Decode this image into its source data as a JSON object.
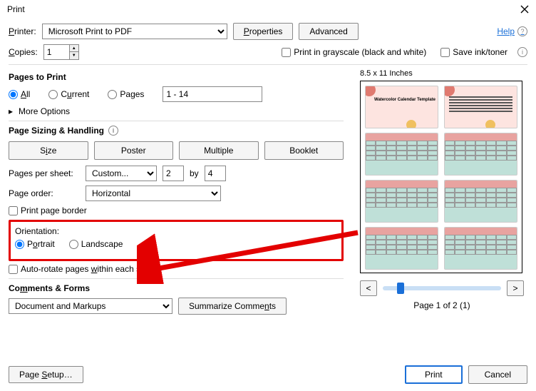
{
  "window": {
    "title": "Print"
  },
  "printerRow": {
    "label": "Printer:",
    "selected": "Microsoft Print to PDF",
    "properties": "Properties",
    "advanced": "Advanced",
    "help": "Help"
  },
  "copiesRow": {
    "label": "Copies:",
    "value": "1",
    "grayscale": "Print in grayscale (black and white)",
    "saveink": "Save ink/toner"
  },
  "pagesToPrint": {
    "title": "Pages to Print",
    "all": "All",
    "current": "Current",
    "pages": "Pages",
    "range": "1 - 14",
    "more": "More Options"
  },
  "sizing": {
    "title": "Page Sizing & Handling",
    "size": "Size",
    "poster": "Poster",
    "multiple": "Multiple",
    "booklet": "Booklet",
    "ppsLabel": "Pages per sheet:",
    "ppsValue": "Custom...",
    "ppsW": "2",
    "ppsBy": "by",
    "ppsH": "4",
    "orderLabel": "Page order:",
    "orderValue": "Horizontal",
    "ppb": "Print page border"
  },
  "orientation": {
    "title": "Orientation:",
    "portrait": "Portrait",
    "landscape": "Landscape",
    "autorotate": "Auto-rotate pages within each sheet"
  },
  "comments": {
    "title": "Comments & Forms",
    "selected": "Document and Markups",
    "summarize": "Summarize Comments"
  },
  "preview": {
    "size": "8.5 x 11 Inches",
    "titleSlide": "Watercolor Calendar Template",
    "pageinfo": "Page 1 of 2 (1)"
  },
  "footer": {
    "pagesetup": "Page Setup...",
    "print": "Print",
    "cancel": "Cancel"
  }
}
